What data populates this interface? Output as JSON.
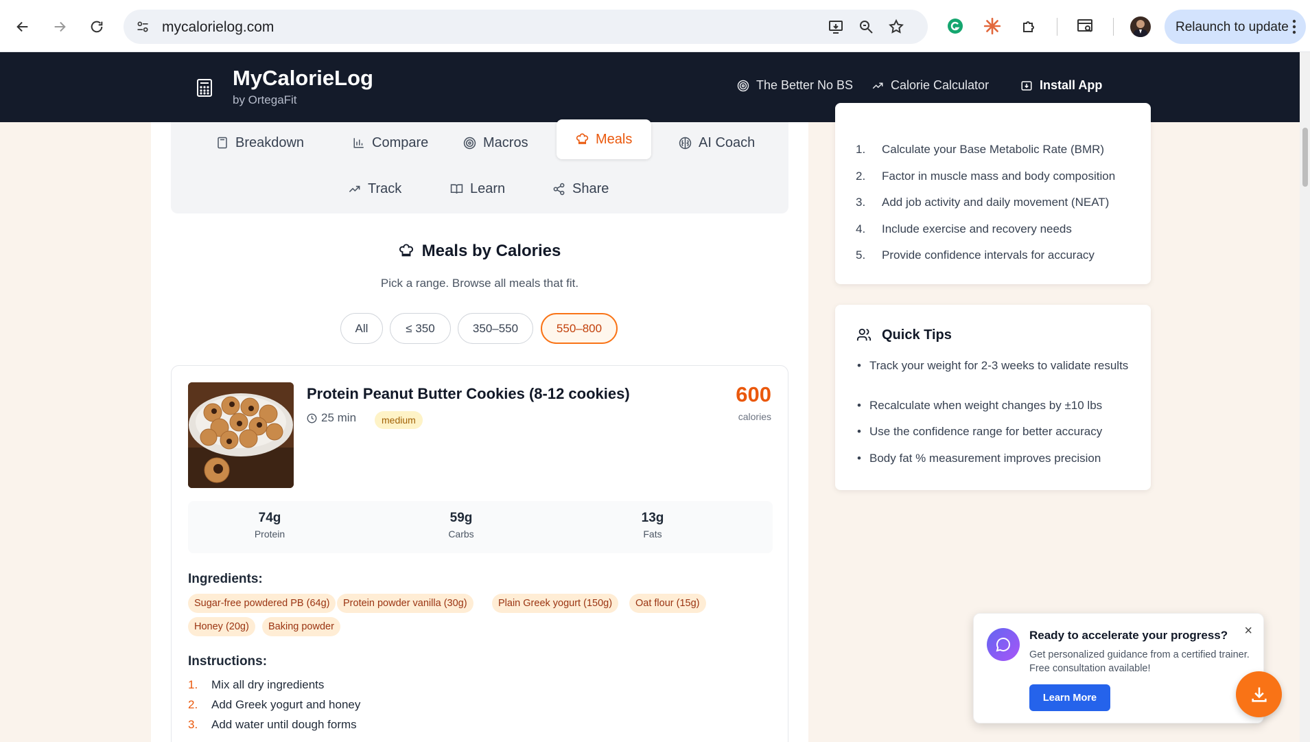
{
  "browser": {
    "url": "mycalorielog.com",
    "relaunch_label": "Relaunch to update"
  },
  "header": {
    "brand": "MyCalorieLog",
    "byline": "by OrtegaFit",
    "nav": [
      {
        "label": "The Better No BS",
        "icon": "target-icon"
      },
      {
        "label": "Calorie Calculator",
        "icon": "trend-icon"
      },
      {
        "label": "Install App",
        "icon": "install-icon"
      }
    ]
  },
  "tabs": [
    {
      "label": "Breakdown",
      "icon": "calculator-icon"
    },
    {
      "label": "Compare",
      "icon": "bar-chart-icon"
    },
    {
      "label": "Macros",
      "icon": "target-icon"
    },
    {
      "label": "Meals",
      "icon": "chef-hat-icon",
      "active": true
    },
    {
      "label": "AI Coach",
      "icon": "brain-icon"
    },
    {
      "label": "Track",
      "icon": "trend-icon"
    },
    {
      "label": "Learn",
      "icon": "book-icon"
    },
    {
      "label": "Share",
      "icon": "share-icon"
    }
  ],
  "meals_section": {
    "title": "Meals by Calories",
    "subtitle": "Pick a range. Browse all meals that fit.",
    "filters": [
      "All",
      "≤ 350",
      "350–550",
      "550–800"
    ],
    "active_filter": "550–800"
  },
  "meal": {
    "name": "Protein Peanut Butter Cookies (8-12 cookies)",
    "time": "25 min",
    "difficulty": "medium",
    "calories": "600",
    "calories_label": "calories",
    "macros": [
      {
        "value": "74g",
        "label": "Protein"
      },
      {
        "value": "59g",
        "label": "Carbs"
      },
      {
        "value": "13g",
        "label": "Fats"
      }
    ],
    "ingredients_heading": "Ingredients:",
    "ingredients": [
      "Sugar-free powdered PB (64g)",
      "Protein powder vanilla (30g)",
      "Plain Greek yogurt (150g)",
      "Oat flour (15g)",
      "Honey (20g)",
      "Baking powder"
    ],
    "instructions_heading": "Instructions:",
    "instructions": [
      {
        "n": "1.",
        "text": "Mix all dry ingredients"
      },
      {
        "n": "2.",
        "text": "Add Greek yogurt and honey"
      },
      {
        "n": "3.",
        "text": "Add water until dough forms"
      }
    ]
  },
  "how_it_works": {
    "steps": [
      {
        "n": "1.",
        "text": "Calculate your Base Metabolic Rate (BMR)"
      },
      {
        "n": "2.",
        "text": "Factor in muscle mass and body composition"
      },
      {
        "n": "3.",
        "text": "Add job activity and daily movement (NEAT)"
      },
      {
        "n": "4.",
        "text": "Include exercise and recovery needs"
      },
      {
        "n": "5.",
        "text": "Provide confidence intervals for accuracy"
      }
    ]
  },
  "quick_tips": {
    "title": "Quick Tips",
    "tips": [
      "Track your weight for 2-3 weeks to validate results",
      "Recalculate when weight changes by ±10 lbs",
      "Use the confidence range for better accuracy",
      "Body fat % measurement improves precision"
    ]
  },
  "popup": {
    "title": "Ready to accelerate your progress?",
    "text": "Get personalized guidance from a certified trainer. Free consultation available!",
    "button": "Learn More",
    "close": "×"
  },
  "colors": {
    "accent": "#ea580c",
    "header_bg": "#141b2a",
    "page_bg": "#faf3ec",
    "cta_blue": "#2563eb"
  }
}
